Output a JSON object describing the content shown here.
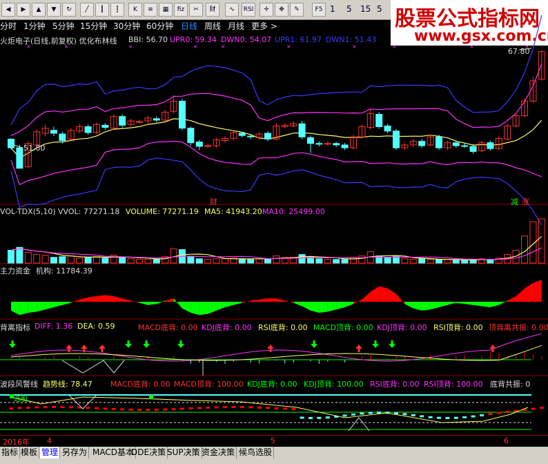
{
  "toolbar": {
    "icons": [
      "back-icon",
      "forward-icon",
      "up-icon",
      "down-icon",
      "refresh-icon",
      "chart-line-icon",
      "candle-icon",
      "bar-icon",
      "k-icon",
      "fiz-icon",
      "list-icon",
      "cut-icon",
      "fin-icon",
      "grid-icon",
      "rsi-icon",
      "move-icon",
      "pen-icon"
    ],
    "f5": "F5",
    "nums": [
      "1",
      "5",
      "15",
      "5"
    ]
  },
  "watermark": {
    "cn": "股票公式指标网",
    "url": "www.gsx.com.cn"
  },
  "periods": [
    "分时",
    "1分钟",
    "5分钟",
    "15分钟",
    "30分钟",
    "60分钟",
    "日线",
    "周线",
    "月线",
    "更多 >"
  ],
  "active_period": "日线",
  "main_panel": {
    "title": "火炬电子(日线,前复权) 优化布林线",
    "bbi": "BBI: 56.70",
    "upr0": "UPR0: 59.34",
    "dwn0": "DWN0: 54.07",
    "upr1": "UPR1: 61.97",
    "dwn1": "DWN1: 51.43",
    "high_label": "67.80",
    "low_label": "51.80",
    "cai_label": "财",
    "jian_label": "减",
    "zhang_label": "涨"
  },
  "vol_panel": {
    "name": "VOL-TDX(5,10)",
    "vvol": "VVOL: 77271.18",
    "volume": "VOLUME: 77271.19",
    "ma5": "MA5: 41943.20",
    "ma10": "MA10: 25499.00"
  },
  "money_panel": {
    "name": "主力资金",
    "jigou": "机构: 11784.39"
  },
  "div_panel": {
    "name": "背离指标",
    "diff": "DIFF: 1.36",
    "dea": "DEA: 0.59",
    "macd_bottom": "MACD底背: 0.00",
    "kdj_bottom": "KDJ底背: 0.00",
    "rsi_bottom": "RSI底背: 0.00",
    "macd_top": "MACD顶背: 0.00",
    "kdj_top": "KDJ顶背: 0.00",
    "rsi_top": "RSI顶背: 0.00",
    "both": "顶背离共振: 0.00"
  },
  "wave_panel": {
    "name": "波段风警线",
    "trend": "趋势线: 78.47",
    "macd_bottom": "MACD底背: 0.00",
    "macd_top": "MACD顶背: 100.00",
    "kdj_bottom": "KDJ底背: 0.00",
    "kdj_top": "KDJ顶背: 100.00",
    "rsi_bottom": "RSI底背: 0.00",
    "rsi_top": "RSI顶背: 100.00",
    "resonance": "底背共振: 0",
    "xuangu": "选股"
  },
  "datebar": {
    "year": "2016年",
    "m4": "4",
    "m5": "5",
    "m6": "6"
  },
  "tabs": [
    "指标",
    "模板",
    "管理",
    "另存为",
    "MACD基本",
    "DDE决策",
    "SUP决策",
    "资金决策",
    "候鸟选股"
  ],
  "active_tab": "管理",
  "colors": {
    "up": "#ff3232",
    "down": "#54ffff",
    "upr1": "#3a3aff",
    "upr0": "#ff32ff",
    "bbi": "#ffff64",
    "macd_pos": "#ff0000",
    "macd_neg": "#00ff00"
  },
  "chart_data": {
    "type": "candlestick",
    "candles": [
      [
        55.8,
        54.6,
        55.9,
        54.4
      ],
      [
        54.6,
        51.8,
        55.0,
        51.8
      ],
      [
        52.0,
        55.2,
        55.5,
        51.9
      ],
      [
        55.0,
        56.8,
        57.2,
        54.8
      ],
      [
        56.6,
        57.3,
        57.8,
        56.2
      ],
      [
        57.0,
        56.6,
        57.5,
        56.2
      ],
      [
        56.5,
        55.6,
        56.8,
        55.2
      ],
      [
        55.8,
        57.0,
        57.3,
        55.6
      ],
      [
        56.9,
        57.5,
        57.9,
        56.6
      ],
      [
        57.5,
        56.7,
        57.8,
        56.4
      ],
      [
        56.7,
        57.8,
        58.1,
        56.5
      ],
      [
        57.7,
        57.4,
        58.0,
        57.1
      ],
      [
        57.3,
        58.9,
        59.2,
        57.1
      ],
      [
        58.9,
        57.7,
        59.2,
        57.4
      ],
      [
        57.8,
        58.3,
        58.6,
        57.5
      ],
      [
        58.2,
        58.2,
        58.5,
        57.9
      ],
      [
        58.3,
        58.7,
        59.0,
        58.0
      ],
      [
        58.6,
        58.4,
        58.9,
        58.1
      ],
      [
        58.4,
        59.5,
        59.8,
        58.2
      ],
      [
        59.6,
        61.0,
        61.8,
        59.3
      ],
      [
        61.0,
        57.3,
        61.3,
        57.0
      ],
      [
        57.3,
        55.3,
        57.5,
        54.9
      ],
      [
        55.4,
        54.8,
        55.7,
        54.3
      ],
      [
        54.9,
        54.9,
        55.2,
        54.6
      ],
      [
        54.9,
        55.7,
        56.0,
        54.6
      ],
      [
        55.6,
        55.9,
        56.2,
        55.3
      ],
      [
        55.9,
        56.7,
        57.0,
        55.6
      ],
      [
        56.6,
        56.3,
        56.8,
        56.0
      ],
      [
        56.2,
        56.1,
        56.5,
        55.8
      ],
      [
        56.0,
        56.5,
        56.8,
        55.7
      ],
      [
        56.6,
        55.8,
        56.9,
        55.5
      ],
      [
        55.8,
        57.6,
        58.0,
        55.6
      ],
      [
        57.5,
        57.7,
        58.0,
        57.3
      ],
      [
        57.6,
        57.9,
        58.3,
        57.4
      ],
      [
        57.9,
        56.1,
        58.3,
        55.8
      ],
      [
        56.0,
        55.2,
        56.3,
        53.9
      ],
      [
        55.2,
        55.1,
        55.5,
        54.8
      ],
      [
        55.1,
        55.2,
        55.5,
        54.9
      ],
      [
        55.2,
        55.0,
        55.4,
        54.7
      ],
      [
        55.0,
        54.6,
        55.3,
        54.3
      ],
      [
        54.6,
        56.1,
        56.4,
        54.4
      ],
      [
        56.1,
        57.5,
        57.8,
        55.9
      ],
      [
        57.4,
        59.3,
        60.0,
        57.1
      ],
      [
        59.2,
        57.5,
        59.5,
        57.2
      ],
      [
        57.6,
        56.9,
        57.9,
        56.6
      ],
      [
        56.9,
        54.6,
        57.2,
        54.3
      ],
      [
        54.6,
        55.0,
        55.3,
        54.3
      ],
      [
        55.0,
        55.5,
        55.8,
        54.7
      ],
      [
        55.5,
        54.9,
        55.8,
        54.6
      ],
      [
        55.0,
        56.1,
        56.4,
        54.8
      ],
      [
        56.1,
        54.6,
        56.4,
        54.3
      ],
      [
        54.6,
        55.3,
        55.6,
        54.3
      ],
      [
        55.3,
        54.9,
        55.6,
        54.6
      ],
      [
        54.9,
        54.8,
        55.2,
        54.6
      ],
      [
        54.8,
        54.1,
        55.1,
        53.8
      ],
      [
        54.2,
        55.3,
        55.6,
        54.0
      ],
      [
        55.3,
        54.5,
        55.6,
        54.2
      ],
      [
        54.5,
        55.9,
        56.2,
        54.3
      ],
      [
        55.8,
        57.6,
        57.9,
        55.6
      ],
      [
        57.6,
        59.0,
        59.4,
        57.4
      ],
      [
        59.0,
        61.0,
        61.4,
        58.8
      ],
      [
        61.0,
        63.8,
        64.3,
        60.8
      ],
      [
        64.0,
        67.8,
        68.0,
        63.8
      ]
    ],
    "volumes": [
      18,
      22,
      15,
      12,
      11,
      8,
      9,
      10,
      7,
      8,
      9,
      7,
      11,
      8,
      6,
      5,
      5,
      5,
      9,
      20,
      19,
      9,
      6,
      5,
      6,
      6,
      7,
      6,
      5,
      6,
      6,
      10,
      8,
      8,
      12,
      9,
      6,
      5,
      5,
      5,
      8,
      10,
      16,
      10,
      8,
      9,
      6,
      5,
      6,
      5,
      5,
      5,
      4,
      4,
      5,
      6,
      5,
      7,
      12,
      18,
      38,
      58,
      62
    ],
    "money": [
      -8,
      -12,
      -10,
      -9,
      -7,
      -5,
      -3,
      -1,
      2,
      4,
      5,
      6,
      5,
      3,
      1,
      -1,
      -3,
      -2,
      1,
      3,
      -6,
      -10,
      -12,
      -11,
      -8,
      -5,
      -3,
      -1,
      1,
      2,
      3,
      3,
      1,
      -1,
      -4,
      -8,
      -10,
      -9,
      -7,
      -5,
      -2,
      2,
      9,
      14,
      12,
      7,
      -2,
      -6,
      -8,
      -7,
      -5,
      -3,
      -1,
      -2,
      -3,
      -4,
      -5,
      -3,
      1,
      5,
      12,
      17,
      20
    ],
    "xlabels": [
      "2016年",
      "4",
      "5",
      "6"
    ]
  }
}
